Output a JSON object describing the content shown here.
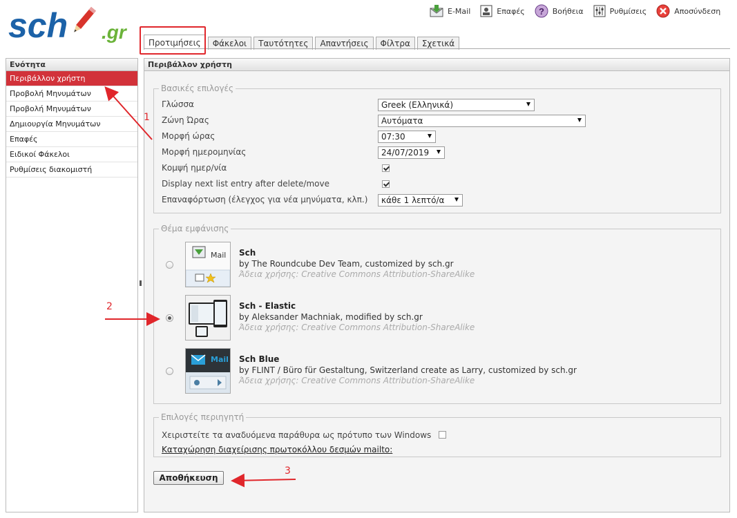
{
  "logo": {
    "text_main": "sch",
    "text_domain": ".gr"
  },
  "toolbar": [
    {
      "label": "E-Mail",
      "icon": "mail-download-icon"
    },
    {
      "label": "Επαφές",
      "icon": "contacts-icon"
    },
    {
      "label": "Βοήθεια",
      "icon": "help-icon"
    },
    {
      "label": "Ρυθμίσεις",
      "icon": "settings-icon"
    },
    {
      "label": "Αποσύνδεση",
      "icon": "logout-icon"
    }
  ],
  "tabs": [
    {
      "label": "Προτιμήσεις",
      "active": true
    },
    {
      "label": "Φάκελοι"
    },
    {
      "label": "Ταυτότητες"
    },
    {
      "label": "Απαντήσεις"
    },
    {
      "label": "Φίλτρα"
    },
    {
      "label": "Σχετικά"
    }
  ],
  "sections": {
    "header": "Ενότητα",
    "items": [
      "Περιβάλλον χρήστη",
      "Προβολή Μηνυμάτων",
      "Προβολή Μηνυμάτων",
      "Δημιουργία Μηνυμάτων",
      "Επαφές",
      "Ειδικοί Φάκελοι",
      "Ρυθμίσεις διακομιστή"
    ]
  },
  "main": {
    "header": "Περιβάλλον χρήστη",
    "basic": {
      "legend": "Βασικές επιλογές",
      "language_label": "Γλώσσα",
      "language_value": "Greek (Ελληνικά)",
      "timezone_label": "Ζώνη Ώρας",
      "timezone_value": "Αυτόματα",
      "time_format_label": "Μορφή ώρας",
      "time_format_value": "07:30",
      "date_format_label": "Μορφή ημερομηνίας",
      "date_format_value": "24/07/2019",
      "pretty_date_label": "Κομψή ημερ/νία",
      "pretty_date_checked": true,
      "next_entry_label": "Display next list entry after delete/move",
      "next_entry_checked": true,
      "refresh_label": "Επαναφόρτωση (έλεγχος για νέα μηνύματα, κλπ.)",
      "refresh_value": "κάθε 1 λεπτό/α"
    },
    "skin": {
      "legend": "Θέμα εμφάνισης",
      "items": [
        {
          "name": "Sch",
          "author": "by The Roundcube Dev Team, customized by sch.gr",
          "license": "Άδεια χρήσης: Creative Commons Attribution-ShareAlike",
          "selected": false,
          "thumb_text": "Mail"
        },
        {
          "name": "Sch - Elastic",
          "author": "by Aleksander Machniak, modified by sch.gr",
          "license": "Άδεια χρήσης: Creative Commons Attribution-ShareAlike",
          "selected": true
        },
        {
          "name": "Sch Blue",
          "author": "by FLINT / Büro für Gestaltung, Switzerland create as Larry, customized by sch.gr",
          "license": "Άδεια χρήσης: Creative Commons Attribution-ShareAlike",
          "selected": false,
          "thumb_text": "Mail"
        }
      ]
    },
    "browser": {
      "legend": "Επιλογές περιηγητή",
      "popup_label": "Χειριστείτε τα αναδυόμενα παράθυρα ως πρότυπο των Windows",
      "popup_checked": false,
      "mailto_link": "Καταχώρηση διαχείρισης πρωτοκόλλου δεσμών mailto:"
    },
    "save_label": "Αποθήκευση"
  },
  "annotations": {
    "n1": "1",
    "n2": "2",
    "n3": "3"
  },
  "colors": {
    "accent_red": "#d2323a",
    "annotation_red": "#e0262b"
  }
}
